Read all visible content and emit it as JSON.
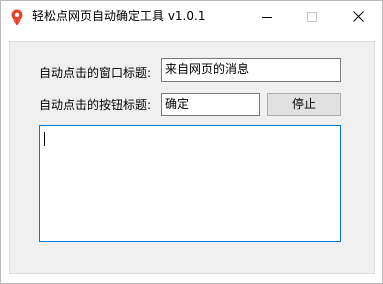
{
  "window": {
    "title": "轻松点网页自动确定工具 v1.0.1"
  },
  "form": {
    "window_title_label": "自动点击的窗口标题:",
    "window_title_value": "来自网页的消息",
    "button_title_label": "自动点击的按钮标题:",
    "button_title_value": "确定",
    "stop_button_label": "停止"
  },
  "log": {
    "content": ""
  },
  "colors": {
    "focus_border": "#0078d7",
    "client_background": "#f0f0f0",
    "icon_red": "#e8412c"
  }
}
